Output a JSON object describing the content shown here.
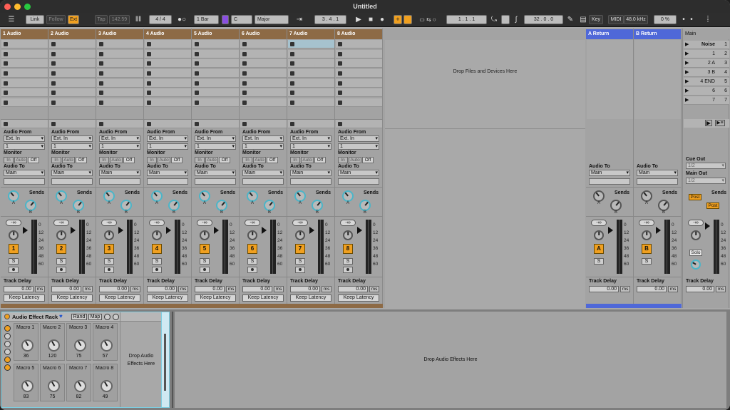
{
  "window": {
    "title": "Untitled"
  },
  "toolbar": {
    "link": "Link",
    "follow": "Follow",
    "ext": "Ext",
    "tap": "Tap",
    "tempo": "142.59",
    "signature": "4 / 4",
    "quantize": "1 Bar",
    "key_root": "C",
    "key_scale": "Major",
    "position": "3 .  4 .  1",
    "loop_start": "1 .  1 .  1",
    "loop_length": "32 .  0 .  0",
    "key_label": "Key",
    "midi_label": "MIDI",
    "sample_rate": "48.0 kHz",
    "cpu": "0 %"
  },
  "tracks": [
    {
      "name": "1 Audio",
      "number": "1"
    },
    {
      "name": "2 Audio",
      "number": "2"
    },
    {
      "name": "3 Audio",
      "number": "3"
    },
    {
      "name": "4 Audio",
      "number": "4"
    },
    {
      "name": "5 Audio",
      "number": "5"
    },
    {
      "name": "6 Audio",
      "number": "6"
    },
    {
      "name": "7 Audio",
      "number": "7"
    },
    {
      "name": "8 Audio",
      "number": "8"
    }
  ],
  "returns": [
    {
      "name": "A Return",
      "letter": "A"
    },
    {
      "name": "B Return",
      "letter": "B"
    }
  ],
  "main": {
    "name": "Main",
    "scenes": [
      {
        "name": "Noise",
        "num": "1"
      },
      {
        "name": "1",
        "num": "2"
      },
      {
        "name": "2 A",
        "num": "3"
      },
      {
        "name": "3 B",
        "num": "4"
      },
      {
        "name": "4 END",
        "num": "5"
      },
      {
        "name": "6",
        "num": "6"
      },
      {
        "name": "7",
        "num": "7"
      }
    ],
    "cue_out_label": "Cue Out",
    "cue_out": "1/2",
    "main_out_label": "Main Out",
    "main_out": "1/2",
    "solo": "Solo",
    "post": "Post"
  },
  "io": {
    "audio_from": "Audio From",
    "ext_in": "Ext. In",
    "channel": "1",
    "monitor": "Monitor",
    "mon_in": "In",
    "mon_auto": "Auto",
    "mon_off": "Off",
    "audio_to": "Audio To",
    "main": "Main",
    "sends": "Sends",
    "send_a": "A",
    "send_b": "B"
  },
  "mixer": {
    "volume": "-∞",
    "solo": "S",
    "scale": [
      "0",
      "12",
      "24",
      "36",
      "48",
      "60"
    ],
    "track_delay": "Track Delay",
    "delay_value": "0.00",
    "delay_unit": "ms",
    "keep_latency": "Keep Latency"
  },
  "session": {
    "drop_hint": "Drop Files and Devices Here"
  },
  "device": {
    "rack_name": "Audio Effect Rack",
    "rand": "Rand",
    "map": "Map",
    "macros": [
      {
        "label": "Macro 1",
        "value": "36"
      },
      {
        "label": "Macro 2",
        "value": "120"
      },
      {
        "label": "Macro 3",
        "value": "75"
      },
      {
        "label": "Macro 4",
        "value": "57"
      },
      {
        "label": "Macro 5",
        "value": "83"
      },
      {
        "label": "Macro 6",
        "value": "75"
      },
      {
        "label": "Macro 7",
        "value": "82"
      },
      {
        "label": "Macro 8",
        "value": "49"
      }
    ],
    "rack_drop_hint": "Drop Audio Effects Here",
    "chain_drop_hint": "Drop Audio Effects Here"
  },
  "colors": {
    "clip_header": "#8d6a45",
    "return_header": "#4f68d8",
    "accent": "#f0a020",
    "rack_border": "#7ecde0"
  }
}
